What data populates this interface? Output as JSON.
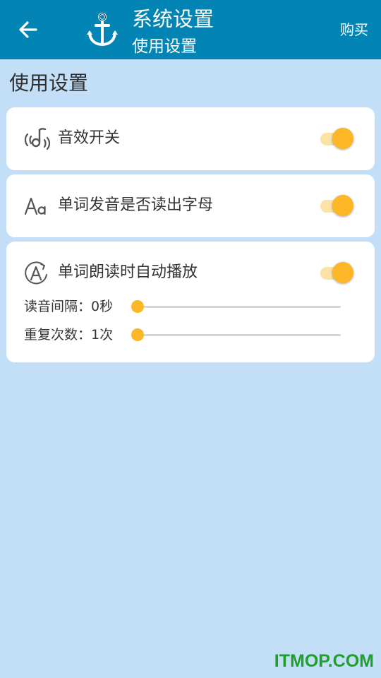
{
  "appbar": {
    "title": "系统设置",
    "subtitle": "使用设置",
    "buy_label": "购买",
    "back_icon": "arrow-left-icon",
    "logo_icon": "anchor-icon",
    "background_color": "#0285b4"
  },
  "section": {
    "title": "使用设置"
  },
  "settings": [
    {
      "label": "音效开关",
      "icon": "sound-effect-icon",
      "enabled": true
    },
    {
      "label": "单词发音是否读出字母",
      "icon": "font-aa-icon",
      "enabled": true
    },
    {
      "label": "单词朗读时自动播放",
      "icon": "auto-play-a-icon",
      "enabled": true,
      "sliders": [
        {
          "label": "读音间隔：0秒",
          "value": 0,
          "value_fraction": 0
        },
        {
          "label": "重复次数：1次",
          "value": 1,
          "value_fraction": 0
        }
      ]
    }
  ],
  "watermark": "ITMOP.COM",
  "colors": {
    "page_background": "#c2dff7",
    "accent": "#fcb626",
    "accent_track": "#fbe3a6",
    "watermark": "#1f9f2b"
  }
}
